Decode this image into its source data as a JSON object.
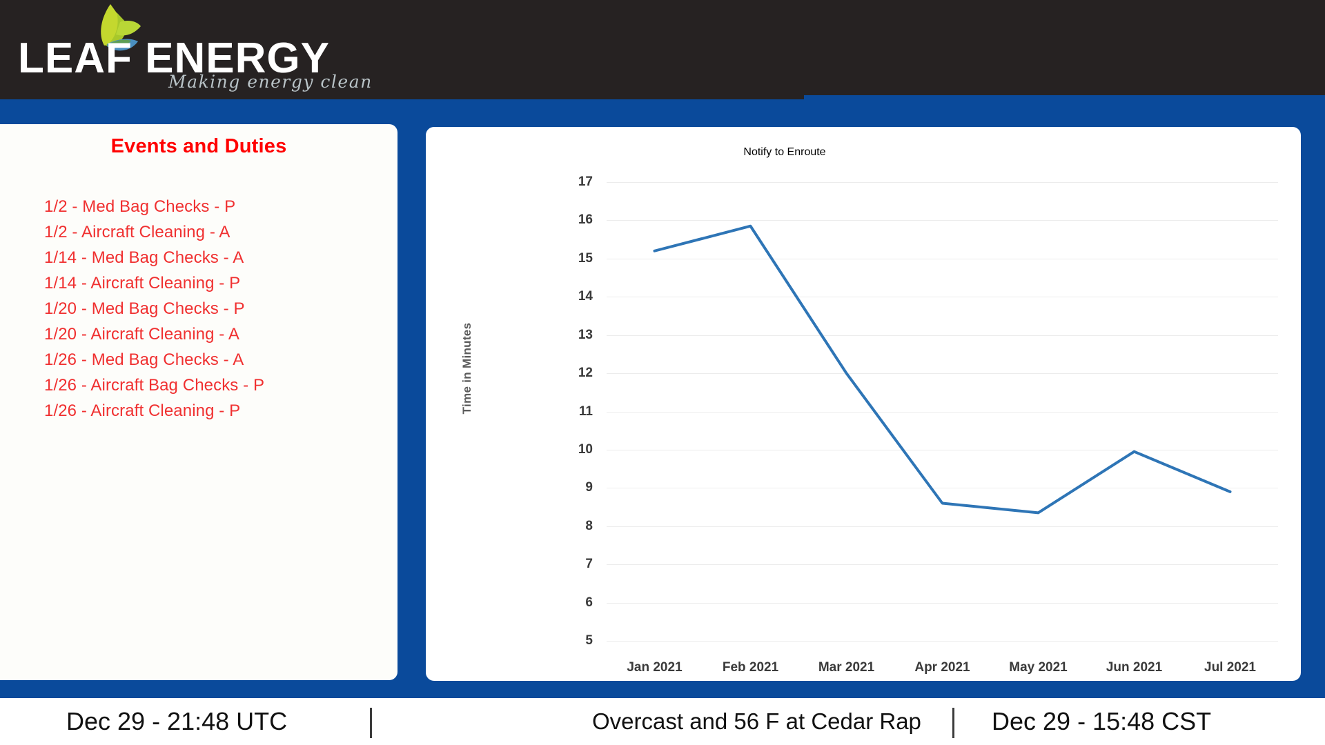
{
  "brand": {
    "name": "LEAF ENERGY",
    "tagline": "Making energy clean",
    "leaf_icon": "leaf-icon",
    "header_bg": "#262222",
    "band_color": "#0a4a9b"
  },
  "events_panel": {
    "title": "Events and Duties",
    "title_color": "#ff0000",
    "items": [
      "1/2 - Med Bag Checks - P",
      "1/2 - Aircraft Cleaning - A",
      "1/14 - Med Bag Checks - A",
      "1/14 - Aircraft Cleaning - P",
      "1/20 - Med Bag Checks - P",
      "1/20 - Aircraft Cleaning - A",
      "1/26 - Med Bag Checks - A",
      "1/26 - Aircraft Bag Checks - P",
      "1/26 - Aircraft Cleaning - P"
    ]
  },
  "chart_data": {
    "type": "line",
    "title": "Notify to Enroute",
    "xlabel": "",
    "ylabel": "Time in Minutes",
    "categories": [
      "Jan 2021",
      "Feb 2021",
      "Mar 2021",
      "Apr 2021",
      "May 2021",
      "Jun 2021",
      "Jul 2021"
    ],
    "values": [
      15.2,
      15.85,
      12.0,
      8.6,
      8.35,
      9.95,
      8.9
    ],
    "series": [
      {
        "name": "Notify to Enroute",
        "values": [
          15.2,
          15.85,
          12.0,
          8.6,
          8.35,
          9.95,
          8.9
        ]
      }
    ],
    "ylim": [
      5,
      17
    ],
    "yticks": [
      17,
      16,
      15,
      14,
      13,
      12,
      11,
      10,
      9,
      8,
      7,
      6,
      5
    ],
    "grid": true,
    "legend": "none",
    "line_color": "#2e75b6",
    "grid_color": "#ececec"
  },
  "footer": {
    "utc_time": "Dec 29 - 21:48 UTC",
    "weather": "Overcast and 56 F at Cedar Rap",
    "local_time": "Dec 29 - 15:48 CST",
    "divider": "|"
  }
}
